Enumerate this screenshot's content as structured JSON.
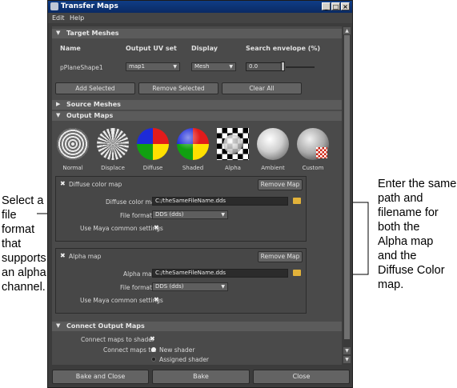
{
  "window": {
    "title": "Transfer Maps"
  },
  "menu": [
    "Edit",
    "Help"
  ],
  "target_meshes": {
    "header": "Target Meshes",
    "columns": [
      "Name",
      "Output UV set",
      "Display",
      "Search envelope (%)"
    ],
    "row": {
      "name": "pPlaneShape1",
      "uv_set": "map1",
      "display": "Mesh",
      "envelope": "0.0"
    },
    "buttons": [
      "Add Selected",
      "Remove Selected",
      "Clear All"
    ]
  },
  "source_meshes": {
    "header": "Source Meshes"
  },
  "output_maps": {
    "header": "Output Maps",
    "maps": [
      "Normal",
      "Displace",
      "Diffuse",
      "Shaded",
      "Alpha",
      "Ambient",
      "Custom"
    ],
    "diffuse": {
      "title": "Diffuse color map",
      "remove": "Remove Map",
      "field_label": "Diffuse color map",
      "path": "C:/theSameFileName.dds",
      "format_label": "File format:",
      "format": "DDS (dds)",
      "common_label": "Use Maya common settings"
    },
    "alpha": {
      "title": "Alpha map",
      "remove": "Remove Map",
      "field_label": "Alpha map",
      "path": "C:/theSameFileName.dds",
      "format_label": "File format:",
      "format": "DDS (dds)",
      "common_label": "Use Maya common settings"
    }
  },
  "connect": {
    "header": "Connect Output Maps",
    "shader_label": "Connect maps to shader",
    "connect_to_label": "Connect maps to:",
    "options": [
      "New shader",
      "Assigned shader"
    ]
  },
  "bottom_buttons": [
    "Bake and Close",
    "Bake",
    "Close"
  ],
  "annotations": {
    "left": [
      "Select a",
      "file",
      "format",
      "that",
      "supports",
      "an alpha",
      "channel."
    ],
    "right": [
      "Enter the same",
      "path and",
      "filename for",
      "both the",
      "Alpha map",
      "and the",
      "Diffuse Color",
      "map."
    ]
  }
}
